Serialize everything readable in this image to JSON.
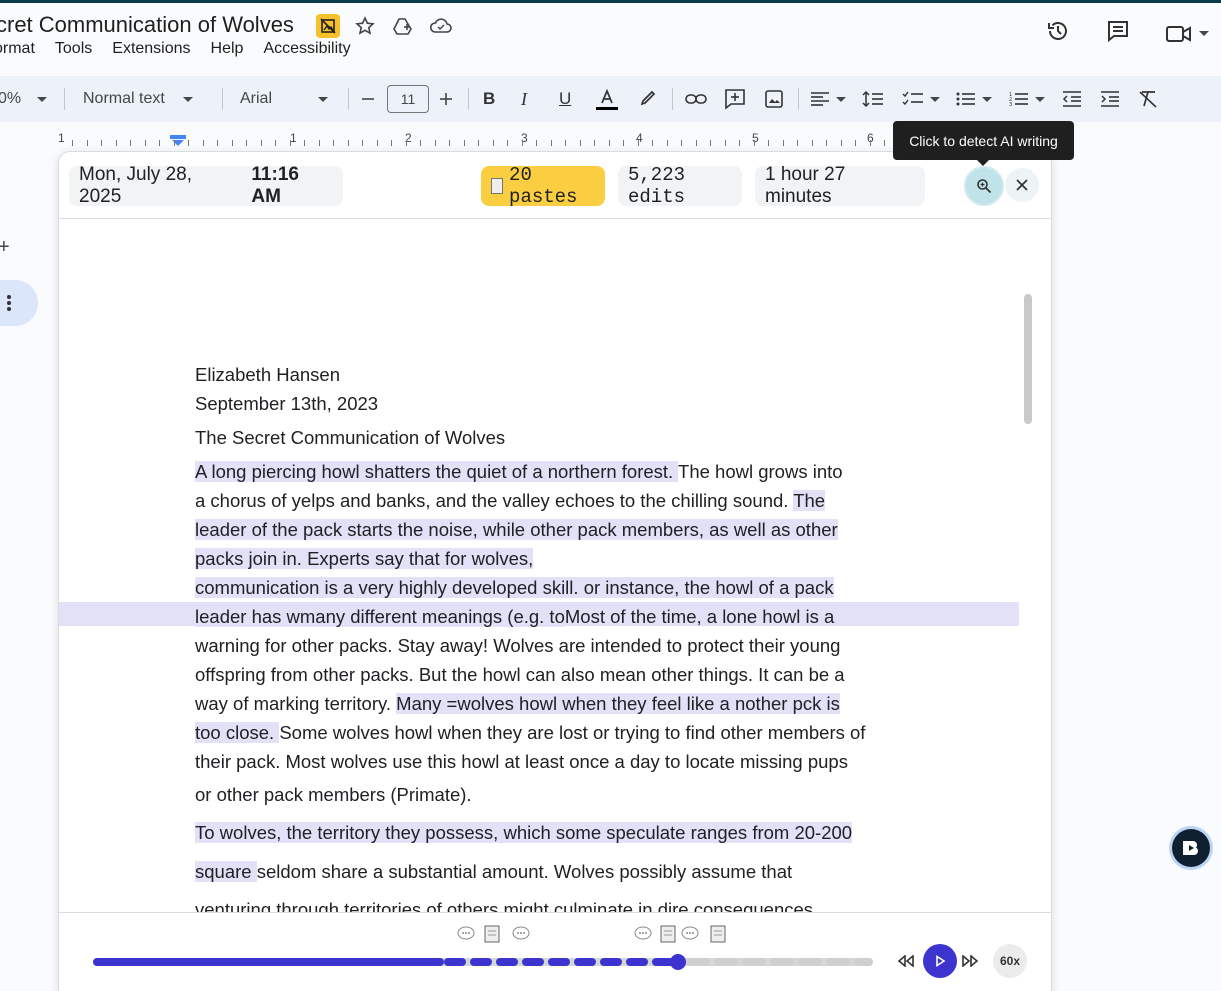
{
  "document": {
    "title": "cret Communication of Wolves"
  },
  "menu": [
    "ormat",
    "Tools",
    "Extensions",
    "Help",
    "Accessibility"
  ],
  "toolbar": {
    "zoom": "0%",
    "style": "Normal text",
    "font": "Arial",
    "font_size": "11"
  },
  "ruler": {
    "numbers": [
      "1",
      "1",
      "2",
      "3",
      "4",
      "5",
      "6"
    ]
  },
  "tooltip": {
    "text": "Click to detect AI writing"
  },
  "panel": {
    "date": "Mon, July 28, 2025",
    "time": "11:16 AM",
    "pastes": "20 pastes",
    "edits": "5,223 edits",
    "duration": "1 hour 27 minutes"
  },
  "doc": {
    "author": "Elizabeth Hansen",
    "date": "September 13th, 2023",
    "title": "The Secret Communication of Wolves",
    "lines": [
      [
        {
          "t": "    ",
          "h": false
        },
        {
          "t": "A long piercing howl shatters the quiet of a northern forest. ",
          "h": true
        },
        {
          "t": "The howl grows into",
          "h": false
        }
      ],
      [
        {
          "t": "a chorus of yelps and banks, and the valley echoes to the chilling sound. ",
          "h": false
        },
        {
          "t": "The ",
          "h": true
        }
      ],
      [
        {
          "t": "leader of the pack starts the noise, while other pack members, as well as other ",
          "h": true
        }
      ],
      [
        {
          "t": "packs join in. ",
          "h": true
        },
        {
          "t": "Experts say that for wolves,",
          "h": true
        }
      ],
      [
        {
          "t": "communication is a very highly developed skill. ",
          "h": true
        },
        {
          "t": "or instance, the howl of a pack ",
          "h": true
        }
      ],
      [
        {
          "t": "leader has wmany different meanings (e.g. to",
          "h": true
        },
        {
          "t": "Most of the time, a lone howl is a",
          "h": false
        }
      ],
      [
        {
          "t": "warning for other packs. Stay away! Wolves are intended to protect their young",
          "h": false
        }
      ],
      [
        {
          "t": "offspring from other packs. But the howl can also mean other things. It can be a",
          "h": false
        }
      ],
      [
        {
          "t": "way of marking territory. ",
          "h": false
        },
        {
          "t": "Many =wolves howl when they feel like a nother pck is ",
          "h": true
        }
      ],
      [
        {
          "t": "too close. ",
          "h": true
        },
        {
          "t": "Some wolves howl when they are lost or trying to find other members of",
          "h": false
        }
      ],
      [
        {
          "t": "their pack. Most wolves use this howl at least once a day to locate missing pups",
          "h": false
        }
      ],
      [
        {
          "t": "or other pack members (Primate).",
          "h": false
        }
      ],
      [
        {
          "t": "To wolves, the territory they possess, which some speculate ranges from 20-200 ",
          "h": true
        }
      ],
      [
        {
          "t": "square  ",
          "h": true
        },
        {
          "t": " seldom share a substantial amount. Wolves possibly assume that",
          "h": false
        }
      ],
      [
        {
          "t": "venturing through territories of others might culminate in dire consequences,",
          "h": false
        }
      ]
    ]
  },
  "timeline": {
    "speed": "60x",
    "progress": 0.75
  },
  "icons": {
    "title_icons": [
      "no-image-badge-icon",
      "star-icon",
      "drive-add-icon",
      "cloud-icon"
    ],
    "right_icons": [
      "history-icon",
      "comment-icon",
      "video-call-icon"
    ]
  }
}
